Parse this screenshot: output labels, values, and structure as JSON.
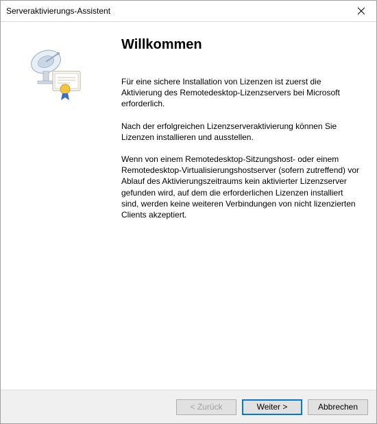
{
  "titlebar": {
    "title": "Serveraktivierungs-Assistent"
  },
  "main": {
    "heading": "Willkommen",
    "para1": "Für eine sichere Installation von Lizenzen ist zuerst die Aktivierung des Remotedesktop-Lizenzservers bei Microsoft erforderlich.",
    "para2": "Nach der erfolgreichen Lizenzserveraktivierung können Sie Lizenzen installieren und ausstellen.",
    "para3": "Wenn von einem Remotedesktop-Sitzungshost- oder einem Remotedesktop-Virtualisierungshostserver (sofern zutreffend) vor Ablauf des Aktivierungszeitraums kein aktivierter Lizenzserver gefunden wird, auf dem die erforderlichen Lizenzen installiert sind, werden keine weiteren Verbindungen von nicht lizenzierten Clients akzeptiert."
  },
  "buttons": {
    "back": "< Zurück",
    "next": "Weiter >",
    "cancel": "Abbrechen"
  }
}
